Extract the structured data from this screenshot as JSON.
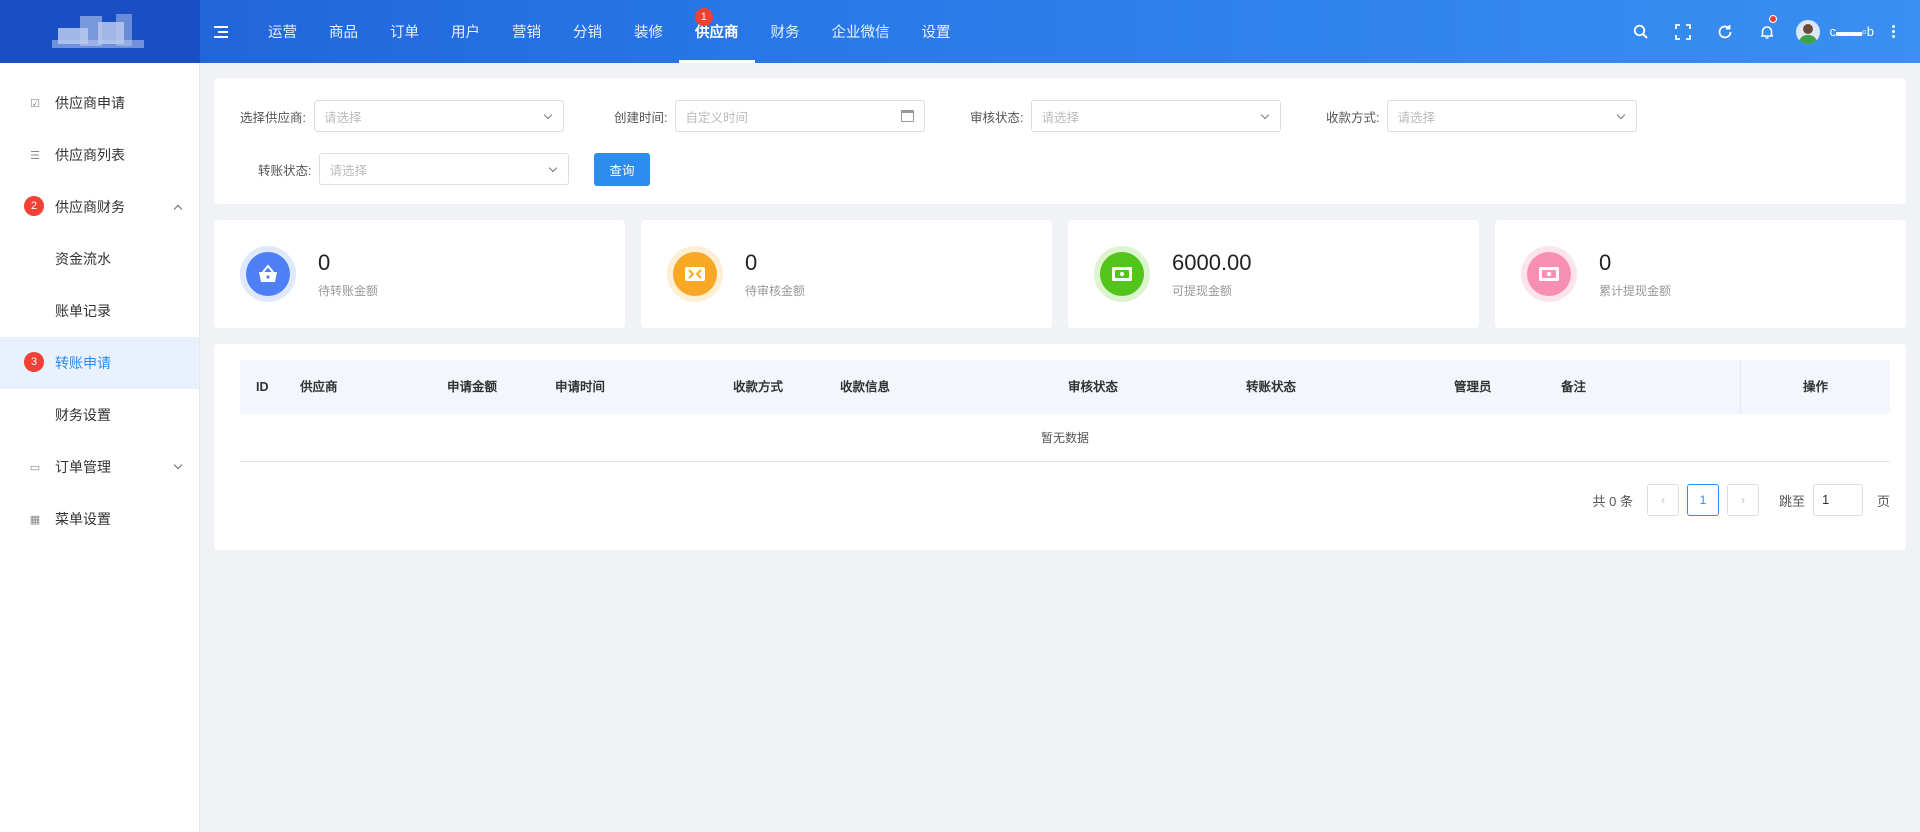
{
  "nav": {
    "items": [
      {
        "label": "运营"
      },
      {
        "label": "商品"
      },
      {
        "label": "订单"
      },
      {
        "label": "用户"
      },
      {
        "label": "营销"
      },
      {
        "label": "分销"
      },
      {
        "label": "装修"
      },
      {
        "label": "供应商",
        "badge": "1",
        "active": true
      },
      {
        "label": "财务"
      },
      {
        "label": "企业微信"
      },
      {
        "label": "设置"
      }
    ]
  },
  "user": {
    "name": "c▬▬▫b"
  },
  "sidebar": {
    "items": [
      {
        "label": "供应商申请",
        "icon": "checkbox-icon"
      },
      {
        "label": "供应商列表",
        "icon": "list-icon"
      },
      {
        "label": "供应商财务",
        "badge": "2",
        "expanded": true
      },
      {
        "label": "资金流水"
      },
      {
        "label": "账单记录"
      },
      {
        "label": "转账申请",
        "badge": "3",
        "active": true
      },
      {
        "label": "财务设置"
      },
      {
        "label": "订单管理",
        "icon": "folder-icon",
        "expanded": false
      },
      {
        "label": "菜单设置",
        "icon": "grid-icon"
      }
    ]
  },
  "filters": {
    "supplier_label": "选择供应商:",
    "supplier_placeholder": "请选择",
    "created_label": "创建时间:",
    "created_placeholder": "自定义时间",
    "audit_label": "审核状态:",
    "audit_placeholder": "请选择",
    "payment_label": "收款方式:",
    "payment_placeholder": "请选择",
    "transfer_label": "转账状态:",
    "transfer_placeholder": "请选择",
    "query_button": "查询"
  },
  "stats": [
    {
      "value": "0",
      "label": "待转账金额",
      "color": "#4e7ff5",
      "ring": "#dfe8fd",
      "icon": "basket-icon"
    },
    {
      "value": "0",
      "label": "待审核金额",
      "color": "#f9a825",
      "ring": "#fdefd3",
      "icon": "money-icon"
    },
    {
      "value": "6000.00",
      "label": "可提现金额",
      "color": "#52c41a",
      "ring": "#def3d0",
      "icon": "cash-icon"
    },
    {
      "value": "0",
      "label": "累计提现金额",
      "color": "#f78fb3",
      "ring": "#fde3ec",
      "icon": "cash-stack-icon"
    }
  ],
  "table": {
    "columns": [
      "ID",
      "供应商",
      "申请金额",
      "申请时间",
      "收款方式",
      "收款信息",
      "审核状态",
      "转账状态",
      "管理员",
      "备注"
    ],
    "action_column": "操作",
    "empty_text": "暂无数据"
  },
  "pagination": {
    "total_text": "共 0 条",
    "current_page": "1",
    "jump_label": "跳至",
    "jump_value": "1",
    "page_suffix": "页"
  }
}
